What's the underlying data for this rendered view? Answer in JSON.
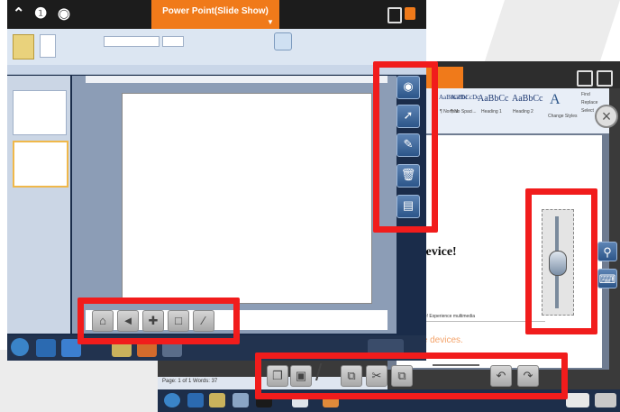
{
  "front_window": {
    "title": "Power Point(Slide Show)"
  },
  "back_window": {
    "styles": [
      {
        "sample": "AaBbCcDc",
        "name": "¶ Normal"
      },
      {
        "sample": "AaBbCcDc",
        "name": "¶ No Spaci..."
      },
      {
        "sample": "AaBbCc",
        "name": "Heading 1"
      },
      {
        "sample": "AaBbCc",
        "name": "Heading 2"
      }
    ],
    "change_styles_label": "Change Styles",
    "find_label": "Find",
    "replace_label": "Replace",
    "select_label": "Select",
    "doc_heading": "e device!",
    "doc_line": "on anywhere! Experience multimedia",
    "doc_orange": "ble devices.",
    "status_text": "Page: 1 of 1   Words: 37"
  },
  "colors": {
    "accent_orange": "#f07a1a",
    "highlight_red": "#f11c1c",
    "tool_blue": "#2c5589"
  },
  "icons": {
    "eye": "view-icon",
    "pointer": "pointer-icon",
    "pen": "pen-icon",
    "trash": "trash-icon",
    "page": "page-icon",
    "home": "home-icon",
    "search": "zoom-icon",
    "keyboard": "keyboard-icon"
  }
}
